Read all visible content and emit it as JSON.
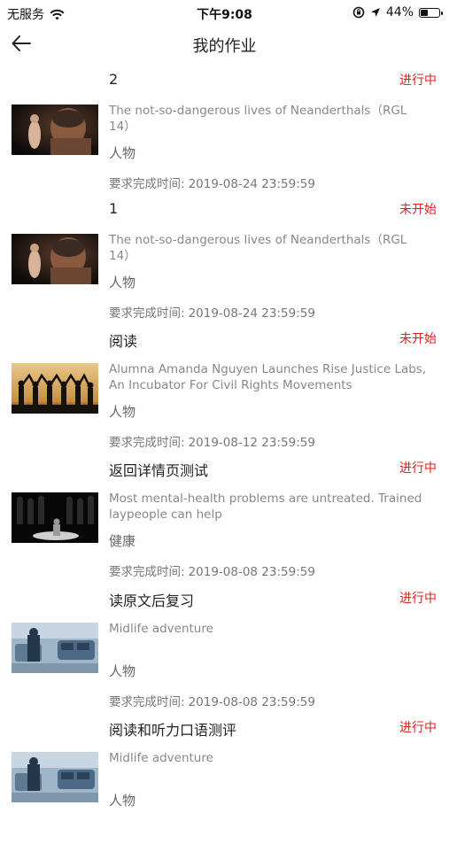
{
  "status_bar": {
    "carrier": "无服务",
    "time": "下午9:08",
    "battery": "44%",
    "battery_level": 0.44
  },
  "header": {
    "title": "我的作业"
  },
  "deadline_label": "要求完成时间:",
  "assignments": [
    {
      "title": "2",
      "status": "进行中",
      "desc": "The not-so-dangerous lives of Neanderthals（RGL 14）",
      "category": "人物",
      "deadline": "2019-08-24 23:59:59",
      "thumb": "neanderthal"
    },
    {
      "title": "1",
      "status": "未开始",
      "desc": "The not-so-dangerous lives of Neanderthals（RGL 14）",
      "category": "人物",
      "deadline": "2019-08-24 23:59:59",
      "thumb": "neanderthal"
    },
    {
      "title": "阅读",
      "status": "未开始",
      "desc": "Alumna Amanda Nguyen Launches Rise Justice Labs, An Incubator For Civil Rights Movements",
      "category": "人物",
      "deadline": "2019-08-12 23:59:59",
      "thumb": "silhouettes"
    },
    {
      "title": "返回详情页测试",
      "status": "进行中",
      "desc": "Most mental-health problems are untreated. Trained laypeople can help",
      "category": "健康",
      "deadline": "2019-08-08 23:59:59",
      "thumb": "crowd"
    },
    {
      "title": "读原文后复习",
      "status": "进行中",
      "desc": "Midlife adventure",
      "category": "人物",
      "deadline": "2019-08-08 23:59:59",
      "thumb": "street"
    },
    {
      "title": "阅读和听力口语测评",
      "status": "进行中",
      "desc": "Midlife adventure",
      "category": "人物",
      "deadline": "",
      "thumb": "street"
    }
  ]
}
